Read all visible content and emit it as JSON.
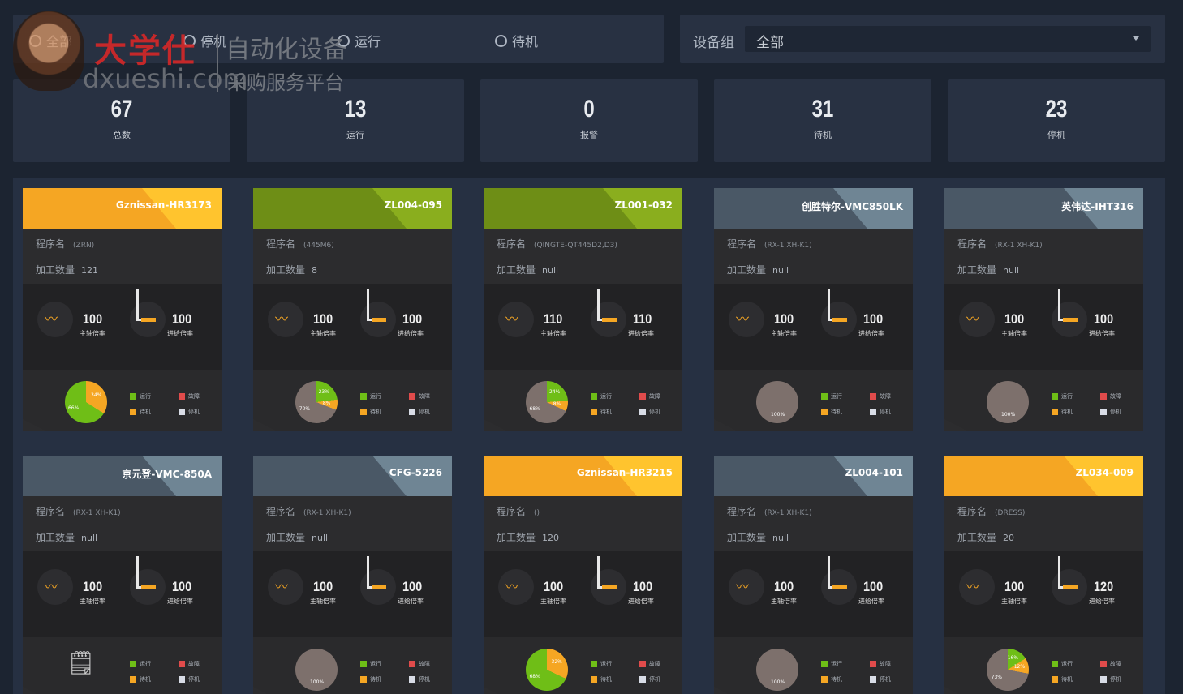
{
  "filters": {
    "all": "全部",
    "stopped": "停机",
    "running": "运行",
    "standby": "待机"
  },
  "group": {
    "label": "设备组",
    "value": "全部"
  },
  "stats": [
    {
      "value": "67",
      "label": "总数"
    },
    {
      "value": "13",
      "label": "运行"
    },
    {
      "value": "0",
      "label": "报警"
    },
    {
      "value": "31",
      "label": "待机"
    },
    {
      "value": "23",
      "label": "停机"
    }
  ],
  "labels": {
    "program": "程序名",
    "count": "加工数量",
    "spindle": "主轴倍率",
    "feed": "进给倍率",
    "legend_run": "运行",
    "legend_fault": "故障",
    "legend_standby": "待机",
    "legend_stop": "停机"
  },
  "watermark": {
    "brand": "大学仕",
    "tag": "自动化设备",
    "url": "dxueshi.com",
    "sub": "采购服务平台"
  },
  "colors": {
    "run": "#6fbe17",
    "standby": "#f5a623",
    "fault": "#e04b4b",
    "stop": "#d8dce6",
    "idle": "#7d706c"
  },
  "cards": [
    {
      "name": "Gznissan-HR3173",
      "program": "(ZRN)",
      "count": "121",
      "spindle": "100",
      "feed": "100",
      "header": "#f5a623",
      "header2": "#ffc42e",
      "pie": [
        {
          "label": "34%",
          "pct": 34,
          "color": "#f5a623"
        },
        {
          "label": "66%",
          "pct": 66,
          "color": "#6fbe17"
        }
      ]
    },
    {
      "name": "ZL004-095",
      "program": "(445M6)",
      "count": "8",
      "spindle": "100",
      "feed": "100",
      "header": "#6e8e16",
      "header2": "#8aae1e",
      "pie": [
        {
          "label": "23%",
          "pct": 23,
          "color": "#6fbe17"
        },
        {
          "label": "8%",
          "pct": 8,
          "color": "#f5a623"
        },
        {
          "label": "70%",
          "pct": 69,
          "color": "#7d706c"
        }
      ]
    },
    {
      "name": "ZL001-032",
      "program": "(QINGTE-QT445D2,D3)",
      "count": "null",
      "spindle": "110",
      "feed": "110",
      "header": "#6e8e16",
      "header2": "#8aae1e",
      "pie": [
        {
          "label": "24%",
          "pct": 24,
          "color": "#6fbe17"
        },
        {
          "label": "8%",
          "pct": 8,
          "color": "#f5a623"
        },
        {
          "label": "68%",
          "pct": 68,
          "color": "#7d706c"
        }
      ]
    },
    {
      "name": "创胜特尔-VMC850LK",
      "program": "(RX-1 XH-K1)",
      "count": "null",
      "spindle": "100",
      "feed": "100",
      "header": "#4a5866",
      "header2": "#6f8594",
      "pie": [
        {
          "label": "100%",
          "pct": 100,
          "color": "#7d706c"
        }
      ]
    },
    {
      "name": "英伟达-IHT316",
      "program": "(RX-1 XH-K1)",
      "count": "null",
      "spindle": "100",
      "feed": "100",
      "header": "#4a5866",
      "header2": "#6f8594",
      "pie": [
        {
          "label": "100%",
          "pct": 100,
          "color": "#7d706c"
        }
      ]
    },
    {
      "name": "京元登-VMC-850A",
      "program": "(RX-1 XH-K1)",
      "count": "null",
      "spindle": "100",
      "feed": "100",
      "header": "#4a5866",
      "header2": "#6f8594",
      "pie": []
    },
    {
      "name": "CFG-5226",
      "program": "(RX-1 XH-K1)",
      "count": "null",
      "spindle": "100",
      "feed": "100",
      "header": "#4a5866",
      "header2": "#6f8594",
      "pie": [
        {
          "label": "100%",
          "pct": 100,
          "color": "#7d706c"
        }
      ]
    },
    {
      "name": "Gznissan-HR3215",
      "program": "()",
      "count": "120",
      "spindle": "100",
      "feed": "100",
      "header": "#f5a623",
      "header2": "#ffc42e",
      "pie": [
        {
          "label": "32%",
          "pct": 32,
          "color": "#f5a623"
        },
        {
          "label": "68%",
          "pct": 68,
          "color": "#6fbe17"
        }
      ]
    },
    {
      "name": "ZL004-101",
      "program": "(RX-1 XH-K1)",
      "count": "null",
      "spindle": "100",
      "feed": "100",
      "header": "#4a5866",
      "header2": "#6f8594",
      "pie": [
        {
          "label": "100%",
          "pct": 100,
          "color": "#7d706c"
        }
      ]
    },
    {
      "name": "ZL034-009",
      "program": "(DRESS)",
      "count": "20",
      "spindle": "100",
      "feed": "120",
      "header": "#f5a623",
      "header2": "#ffc42e",
      "pie": [
        {
          "label": "16%",
          "pct": 16,
          "color": "#6fbe17"
        },
        {
          "label": "12%",
          "pct": 12,
          "color": "#f5a623"
        },
        {
          "label": "73%",
          "pct": 72,
          "color": "#7d706c"
        }
      ]
    }
  ]
}
